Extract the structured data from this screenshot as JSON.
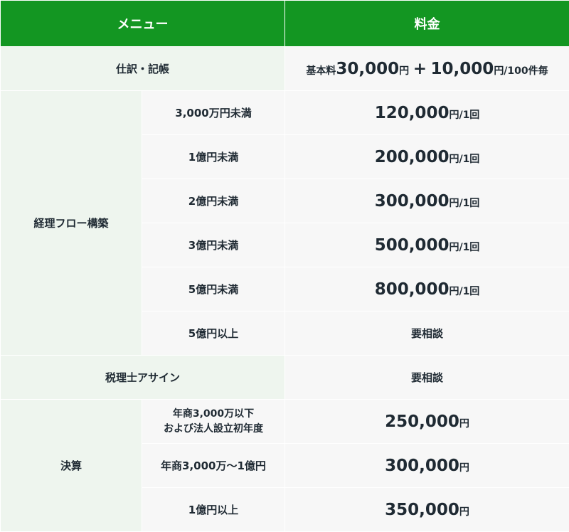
{
  "header": {
    "menu": "メニュー",
    "price": "料金"
  },
  "shiwake": {
    "label": "仕訳・記帳",
    "price_prefix": "基本料",
    "base_amount": "30,000",
    "yen1": "円",
    "plus": "+",
    "extra_amount": "10,000",
    "extra_unit": "円/100件毎"
  },
  "flow": {
    "label": "経理フロー構築",
    "tiers": [
      {
        "sub": "3,000万円未満",
        "amount": "120,000",
        "unit": "円/1回"
      },
      {
        "sub": "1億円未満",
        "amount": "200,000",
        "unit": "円/1回"
      },
      {
        "sub": "2億円未満",
        "amount": "300,000",
        "unit": "円/1回"
      },
      {
        "sub": "3億円未満",
        "amount": "500,000",
        "unit": "円/1回"
      },
      {
        "sub": "5億円未満",
        "amount": "800,000",
        "unit": "円/1回"
      },
      {
        "sub": "5億円以上",
        "price_text": "要相談"
      }
    ]
  },
  "tax": {
    "label": "税理士アサイン",
    "price_text": "要相談"
  },
  "settlement": {
    "label": "決算",
    "tiers": [
      {
        "sub_line1": "年商3,000万以下",
        "sub_line2": "および法人設立初年度",
        "amount": "250,000",
        "unit": "円"
      },
      {
        "sub": "年商3,000万〜1億円",
        "amount": "300,000",
        "unit": "円"
      },
      {
        "sub": "1億円以上",
        "amount": "350,000",
        "unit": "円"
      }
    ]
  }
}
